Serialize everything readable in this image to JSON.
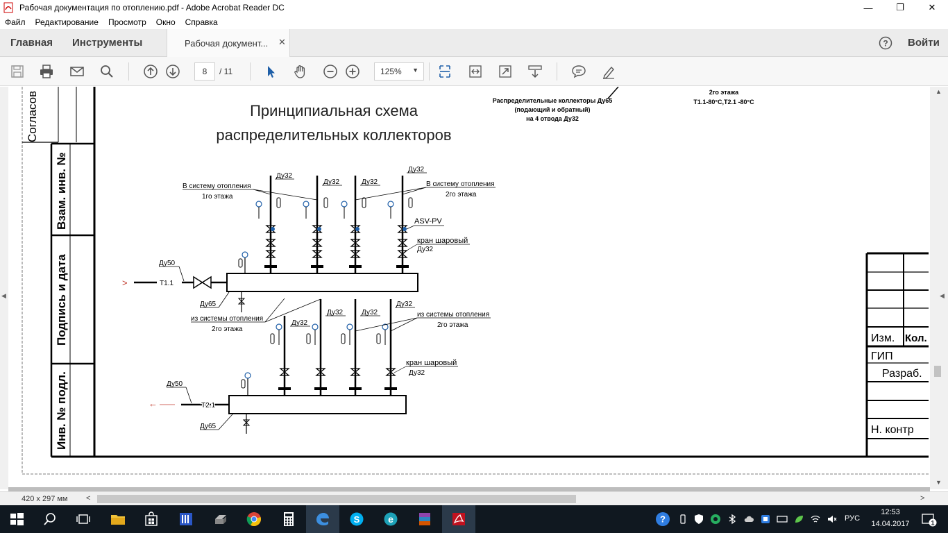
{
  "window": {
    "title": "Рабочая документация по отоплению.pdf - Adobe Acrobat Reader DC",
    "minimize": "—",
    "restore": "❐",
    "close": "✕"
  },
  "menu": [
    "Файл",
    "Редактирование",
    "Просмотр",
    "Окно",
    "Справка"
  ],
  "nav": {
    "home": "Главная",
    "tools": "Инструменты",
    "doc_tab": "Рабочая документ...",
    "doc_tab_close": "✕",
    "signin": "Войти"
  },
  "toolbar": {
    "page_current": "8",
    "page_total": "/ 11",
    "zoom": "125%",
    "zoom_arrow": "▼",
    "icons": [
      "save-icon",
      "print-icon",
      "email-icon",
      "search-icon",
      "page-up-icon",
      "page-down-icon",
      "select-cursor-icon",
      "hand-tool-icon",
      "zoom-out-icon",
      "zoom-in-icon",
      "fit-page-icon",
      "fit-width-icon",
      "full-screen-icon",
      "read-mode-icon",
      "comment-icon",
      "sign-icon"
    ]
  },
  "drawing": {
    "title_line1": "Принципиальная схема",
    "title_line2": "распределительных коллекторов",
    "top_note_line1": "Распределительные коллекторы Ду65",
    "top_note_line2": "(подающий и обратный)",
    "top_note_line3": "на 4 отвода Ду32",
    "top_right_line1": "2го этажа",
    "top_right_line2": "Т1.1-80°С,Т2.1 -80°С",
    "side_labels": {
      "soglasov": "Согласов",
      "vzam": "Взам. инв. №",
      "podpis": "Подпись и дата",
      "inv": "Инв. № подл."
    },
    "supply": {
      "to_system_1": "В систему отопления",
      "floor_1": "1го этажа",
      "to_system_2": "В систему отопления",
      "floor_2": "2го этажа",
      "du32": "Ду32",
      "asv": "ASV-PV",
      "ball_valve": "кран шаровый",
      "ball_valve_du": "Ду32",
      "inlet_du": "Ду50",
      "inlet_code": "Т1.1",
      "header_du": "Ду65"
    },
    "return": {
      "from_system_1": "из системы отопления",
      "floor_1": "2го этажа",
      "from_system_2": "из системы отопления",
      "floor_2": "2го этажа",
      "du32": "Ду32",
      "ball_valve": "кран шаровый",
      "ball_valve_du": "Ду32",
      "outlet_du": "Ду50",
      "outlet_code": "Т2.1",
      "header_du": "Ду65"
    },
    "stamp": {
      "izm": "Изм.",
      "kol": "Кол. у",
      "gip": "ГИП",
      "razrab": "Разраб.",
      "nkontr": "Н. контр"
    }
  },
  "status": {
    "page_size": "420 x 297 мм",
    "scroll_left": "<",
    "scroll_right": ">"
  },
  "taskbar": {
    "lang": "РУС",
    "time": "12:53",
    "date": "14.04.2017",
    "notifications": "1"
  }
}
